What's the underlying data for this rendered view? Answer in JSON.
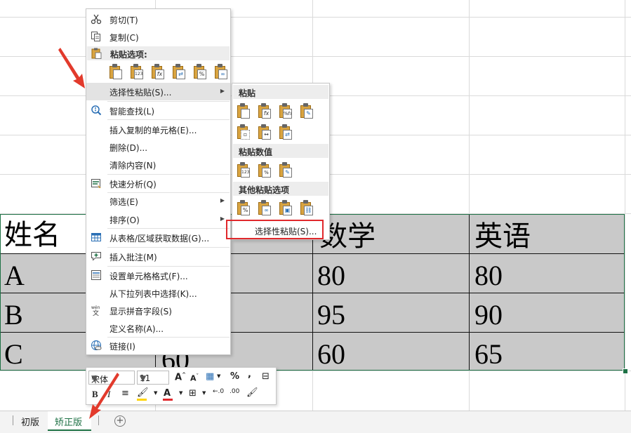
{
  "table": {
    "headers": [
      "姓名",
      "数学",
      "英语"
    ],
    "rows": [
      {
        "name": "A",
        "math": "80",
        "english": "80"
      },
      {
        "name": "B",
        "math": "95",
        "english": "90"
      },
      {
        "name": "C",
        "math": "60",
        "english": "65"
      }
    ],
    "partial_value": "60"
  },
  "context_menu": {
    "cut": "剪切(T)",
    "copy": "复制(C)",
    "paste_options_header": "粘贴选项:",
    "paste_special": "选择性粘贴(S)...",
    "smart_lookup": "智能查找(L)",
    "insert_copied_cells": "插入复制的单元格(E)...",
    "delete": "删除(D)...",
    "clear_contents": "清除内容(N)",
    "quick_analysis": "快速分析(Q)",
    "filter": "筛选(E)",
    "sort": "排序(O)",
    "get_data_from_table": "从表格/区域获取数据(G)...",
    "insert_comment": "插入批注(M)",
    "format_cells": "设置单元格格式(F)...",
    "pick_from_list": "从下拉列表中选择(K)...",
    "show_phonetic": "显示拼音字段(S)",
    "define_name": "定义名称(A)...",
    "link": "链接(I)"
  },
  "paste_submenu": {
    "paste_header": "粘贴",
    "paste_values_header": "粘贴数值",
    "other_options_header": "其他粘贴选项",
    "paste_special": "选择性粘贴(S)..."
  },
  "mini_toolbar": {
    "font": "宋体",
    "size": "11",
    "bold": "B",
    "italic": "I",
    "percent": "%",
    "comma": ","
  },
  "sheet_tabs": [
    {
      "label": "初版",
      "active": false
    },
    {
      "label": "矫正版",
      "active": true
    }
  ],
  "colors": {
    "accent_green": "#1e7145",
    "highlight_red": "#e0282c",
    "table_fill": "#c9c9c9"
  }
}
